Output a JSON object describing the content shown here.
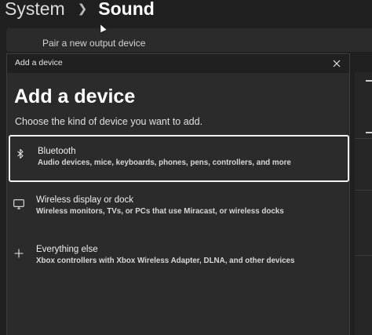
{
  "background": {
    "breadcrumb": {
      "parent": "System",
      "current": "Sound"
    },
    "pair_label": "Pair a new output device"
  },
  "dialog": {
    "window_title": "Add a device",
    "heading": "Add a device",
    "subtitle": "Choose the kind of device you want to add.",
    "options": [
      {
        "icon": "bluetooth-icon",
        "title": "Bluetooth",
        "description": "Audio devices, mice, keyboards, phones, pens, controllers, and more",
        "selected": true
      },
      {
        "icon": "monitor-icon",
        "title": "Wireless display or dock",
        "description": "Wireless monitors, TVs, or PCs that use Miracast, or wireless docks",
        "selected": false
      },
      {
        "icon": "plus-icon",
        "title": "Everything else",
        "description": "Xbox controllers with Xbox Wireless Adapter, DLNA, and other devices",
        "selected": false
      }
    ]
  },
  "colors": {
    "page_background": "#202020",
    "dialog_background": "#2b2b2b",
    "titlebar_background": "#202020",
    "selection_border": "#f2f2f2",
    "text_primary": "#ffffff",
    "text_secondary": "#d8d8d8"
  }
}
